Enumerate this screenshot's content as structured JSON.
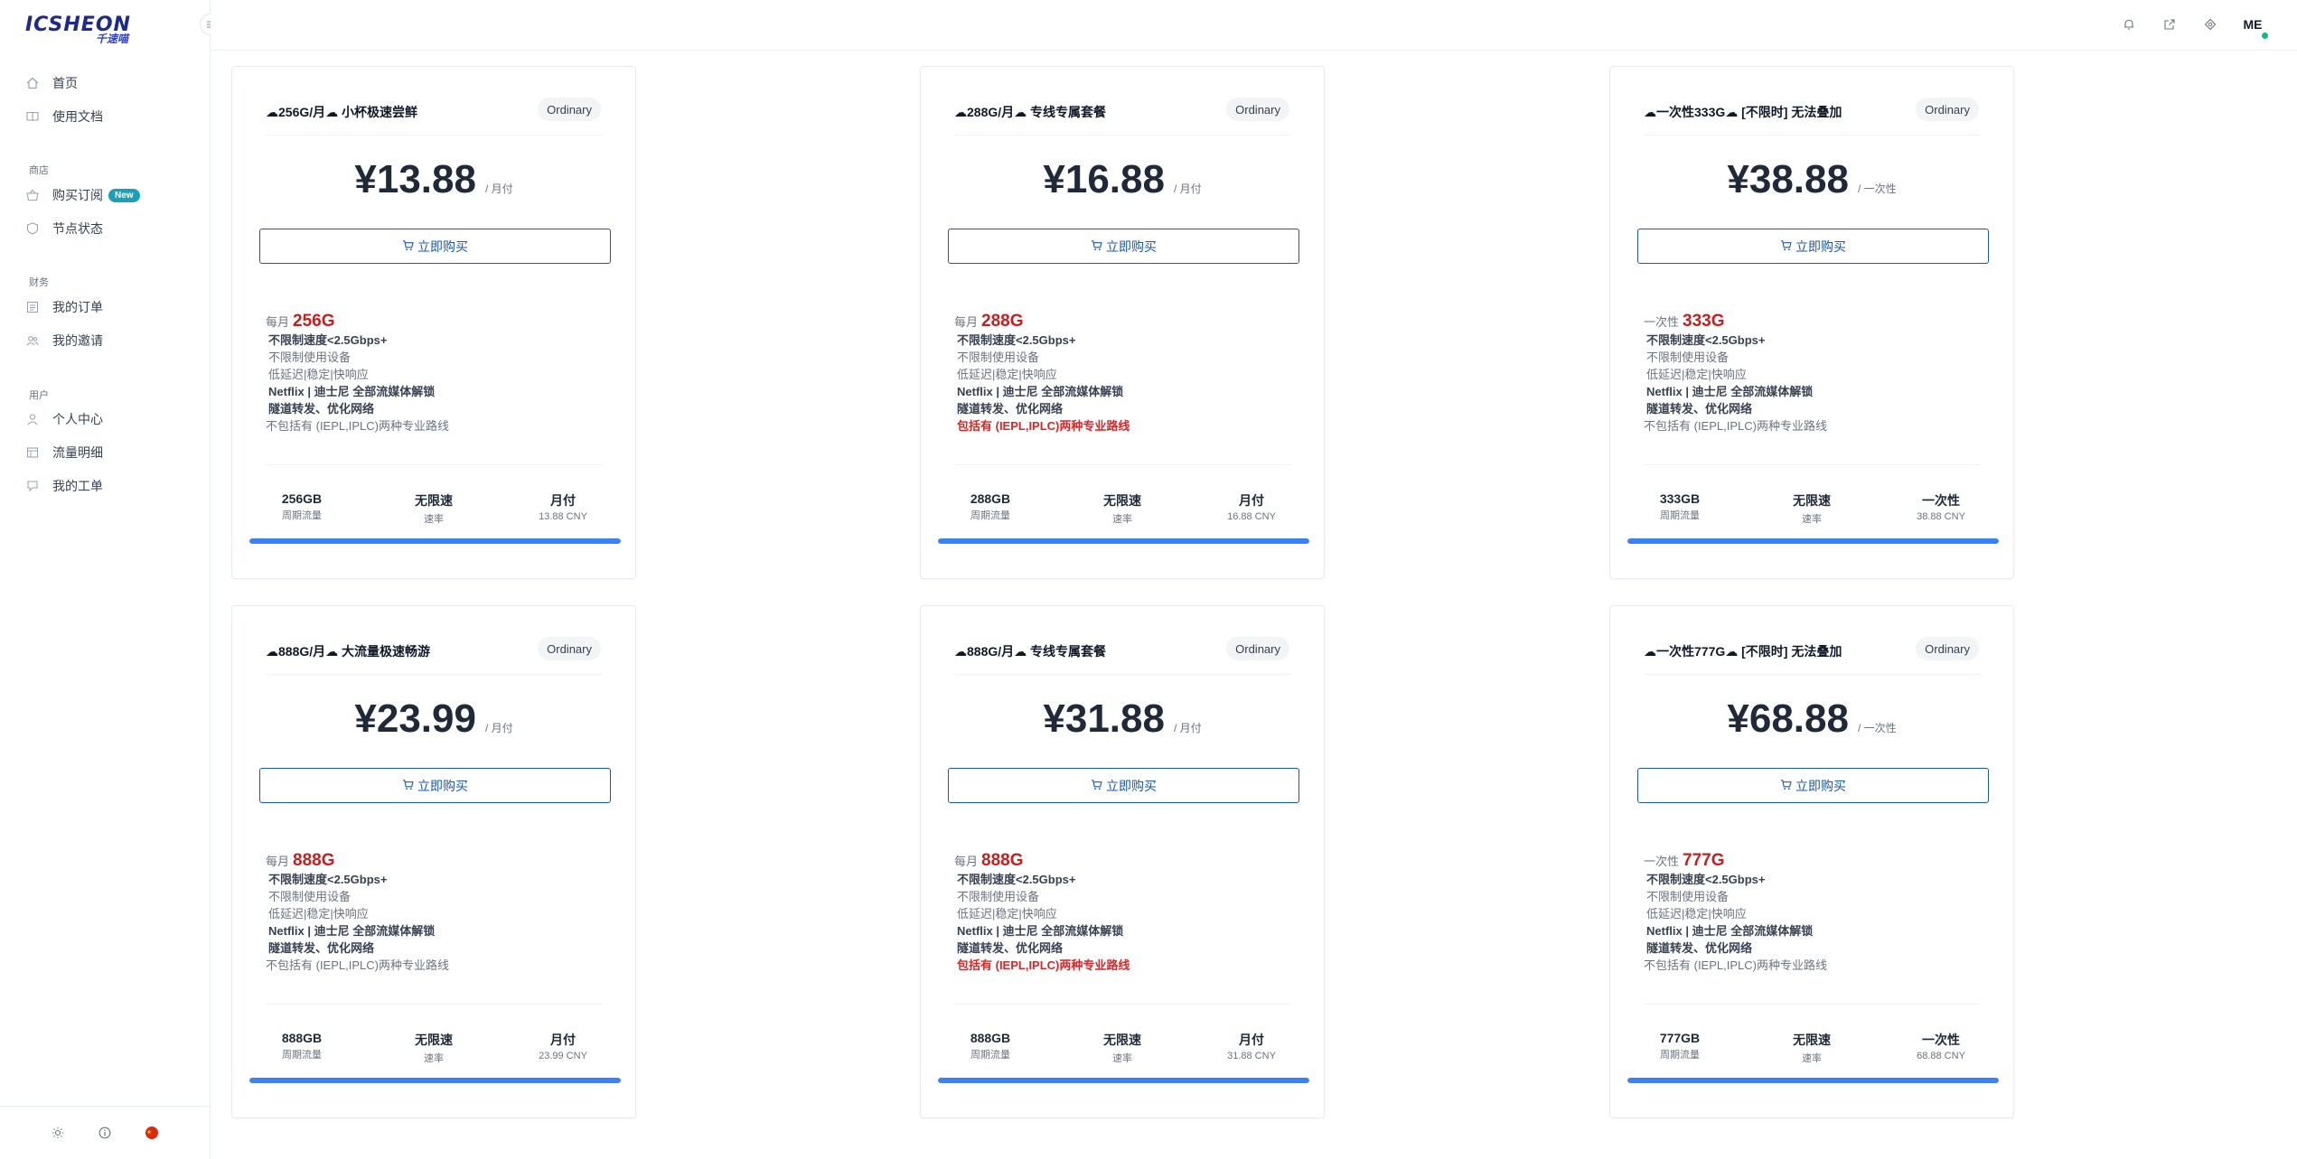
{
  "brand": {
    "logo_text": "ICSHEON",
    "logo_sub": "千速喵"
  },
  "sidebar": {
    "items_top": [
      {
        "label": "首页",
        "icon": "home-icon"
      },
      {
        "label": "使用文档",
        "icon": "book-icon"
      }
    ],
    "groups": [
      {
        "title": "商店",
        "items": [
          {
            "label": "购买订阅",
            "badge": "New"
          },
          {
            "label": "节点状态"
          }
        ]
      },
      {
        "title": "财务",
        "items": [
          {
            "label": "我的订单"
          },
          {
            "label": "我的邀请"
          }
        ]
      },
      {
        "title": "用户",
        "items": [
          {
            "label": "个人中心"
          },
          {
            "label": "流量明细"
          },
          {
            "label": "我的工单"
          }
        ]
      }
    ]
  },
  "header": {
    "avatar": "ME"
  },
  "cards": [
    {
      "title": "☁256G/月☁ 小杯极速尝鲜",
      "tag": "Ordinary",
      "price": "¥13.88",
      "unit": "/ 月付",
      "buy_label": "立即购买",
      "feat_key": "每月",
      "feat_val": "256G",
      "lines": [
        "不限制速度<2.5Gbps+",
        "不限制使用设备",
        "低延迟|稳定|快响应",
        "Netflix | 迪士尼 全部流媒体解锁",
        "隧道转发、优化网络",
        "不包括有 (IEPL,IPLC)两种专业路线"
      ],
      "stats": [
        {
          "v": "256GB",
          "l": "周期流量"
        },
        {
          "v": "无限速",
          "l": "速率"
        },
        {
          "v": "月付",
          "l": "13.88 CNY"
        }
      ],
      "progress": 1.0
    },
    {
      "title": "☁288G/月☁ 专线专属套餐",
      "tag": "Ordinary",
      "price": "¥16.88",
      "unit": "/ 月付",
      "buy_label": "立即购买",
      "feat_key": "每月",
      "feat_val": "288G",
      "lines": [
        "不限制速度<2.5Gbps+",
        "不限制使用设备",
        "低延迟|稳定|快响应",
        "Netflix | 迪士尼 全部流媒体解锁",
        "隧道转发、优化网络",
        "包括有 (IEPL,IPLC)两种专业路线"
      ],
      "stats": [
        {
          "v": "288GB",
          "l": "周期流量"
        },
        {
          "v": "无限速",
          "l": "速率"
        },
        {
          "v": "月付",
          "l": "16.88 CNY"
        }
      ],
      "progress": 1.0
    },
    {
      "title": "☁一次性333G☁ [不限时] 无法叠加",
      "tag": "Ordinary",
      "price": "¥38.88",
      "unit": "/ 一次性",
      "buy_label": "立即购买",
      "feat_key": "一次性",
      "feat_val": "333G",
      "lines": [
        "不限制速度<2.5Gbps+",
        "不限制使用设备",
        "低延迟|稳定|快响应",
        "Netflix | 迪士尼 全部流媒体解锁",
        "隧道转发、优化网络",
        "不包括有 (IEPL,IPLC)两种专业路线"
      ],
      "stats": [
        {
          "v": "333GB",
          "l": "周期流量"
        },
        {
          "v": "无限速",
          "l": "速率"
        },
        {
          "v": "一次性",
          "l": "38.88 CNY"
        }
      ],
      "progress": 1.0
    },
    {
      "title": "☁888G/月☁ 大流量极速畅游",
      "tag": "Ordinary",
      "price": "¥23.99",
      "unit": "/ 月付",
      "buy_label": "立即购买",
      "feat_key": "每月",
      "feat_val": "888G",
      "lines": [
        "不限制速度<2.5Gbps+",
        "不限制使用设备",
        "低延迟|稳定|快响应",
        "Netflix | 迪士尼 全部流媒体解锁",
        "隧道转发、优化网络",
        "不包括有 (IEPL,IPLC)两种专业路线"
      ],
      "stats": [
        {
          "v": "888GB",
          "l": "周期流量"
        },
        {
          "v": "无限速",
          "l": "速率"
        },
        {
          "v": "月付",
          "l": "23.99 CNY"
        }
      ],
      "progress": 1.0
    },
    {
      "title": "☁888G/月☁ 专线专属套餐",
      "tag": "Ordinary",
      "price": "¥31.88",
      "unit": "/ 月付",
      "buy_label": "立即购买",
      "feat_key": "每月",
      "feat_val": "888G",
      "lines": [
        "不限制速度<2.5Gbps+",
        "不限制使用设备",
        "低延迟|稳定|快响应",
        "Netflix | 迪士尼 全部流媒体解锁",
        "隧道转发、优化网络",
        "包括有 (IEPL,IPLC)两种专业路线"
      ],
      "stats": [
        {
          "v": "888GB",
          "l": "周期流量"
        },
        {
          "v": "无限速",
          "l": "速率"
        },
        {
          "v": "月付",
          "l": "31.88 CNY"
        }
      ],
      "progress": 1.0
    },
    {
      "title": "☁一次性777G☁ [不限时] 无法叠加",
      "tag": "Ordinary",
      "price": "¥68.88",
      "unit": "/ 一次性",
      "buy_label": "立即购买",
      "feat_key": "一次性",
      "feat_val": "777G",
      "lines": [
        "不限制速度<2.5Gbps+",
        "不限制使用设备",
        "低延迟|稳定|快响应",
        "Netflix | 迪士尼 全部流媒体解锁",
        "隧道转发、优化网络",
        "不包括有 (IEPL,IPLC)两种专业路线"
      ],
      "stats": [
        {
          "v": "777GB",
          "l": "周期流量"
        },
        {
          "v": "无限速",
          "l": "速率"
        },
        {
          "v": "一次性",
          "l": "68.88 CNY"
        }
      ],
      "progress": 1.0
    }
  ]
}
